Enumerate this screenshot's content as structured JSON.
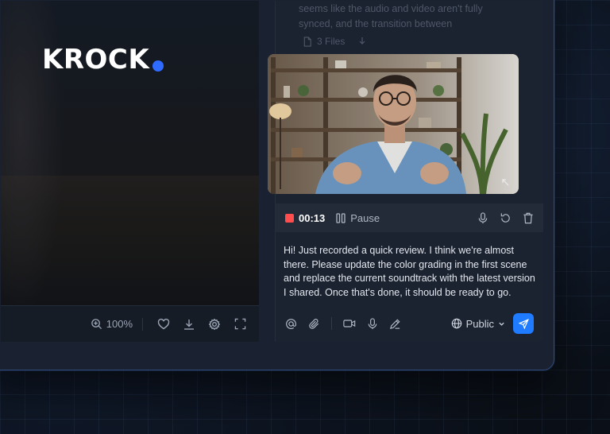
{
  "brand": {
    "name": "KROCK",
    "accent": "#2f6bff"
  },
  "canvas_toolbar": {
    "zoom": "100%",
    "icons": [
      "zoom-in-icon",
      "heart-icon",
      "download-icon",
      "settings-icon",
      "fullscreen-icon"
    ]
  },
  "previous_comment": {
    "text": "This part feels a bit unpolished right now: it seems like the audio and video aren't fully synced, and the transition between",
    "files_label": "3 Files"
  },
  "recording": {
    "time": "00:13",
    "pause_label": "Pause",
    "status_color": "#ff4d4d"
  },
  "comment": {
    "text": "Hi! Just recorded a quick review. I think we're almost there. Please update the color grading in the first scene and replace the current soundtrack with the latest version I shared. Once that's done, it should be ready to go."
  },
  "composer": {
    "visibility": "Public",
    "send_color": "#1f7bff"
  }
}
